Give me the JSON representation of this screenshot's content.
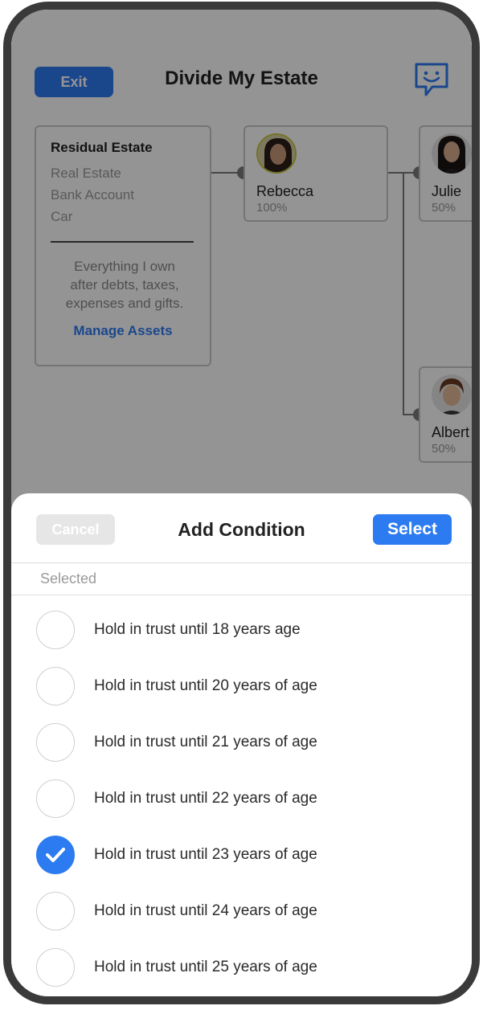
{
  "header": {
    "exit_label": "Exit",
    "title": "Divide My Estate",
    "chat_icon": "support-chat-icon"
  },
  "residual_estate": {
    "title": "Residual Estate",
    "items": [
      "Real Estate",
      "Bank Account",
      "Car"
    ],
    "description_lines": [
      "Everything I own",
      "after debts, taxes,",
      "expenses and gifts."
    ],
    "manage_link": "Manage Assets"
  },
  "beneficiaries": [
    {
      "name": "Rebecca",
      "percent": "100%"
    },
    {
      "name": "Julie",
      "percent": "50%"
    },
    {
      "name": "Albert",
      "percent": "50%"
    }
  ],
  "sheet": {
    "cancel_label": "Cancel",
    "title": "Add Condition",
    "select_label": "Select",
    "selected_label": "Selected",
    "options": [
      {
        "label": "Hold in trust until 18 years age",
        "checked": false
      },
      {
        "label": "Hold in trust until 20 years of age",
        "checked": false
      },
      {
        "label": "Hold in trust until 21 years of age",
        "checked": false
      },
      {
        "label": "Hold in trust until 22 years of age",
        "checked": false
      },
      {
        "label": "Hold in trust until 23 years of age",
        "checked": true
      },
      {
        "label": "Hold in trust until 24 years of age",
        "checked": false
      },
      {
        "label": "Hold in trust until 25 years of age",
        "checked": false
      }
    ]
  },
  "colors": {
    "accent": "#2d7bf1",
    "overlay": "rgba(0,0,0,0.42)",
    "phone_frame": "#3a3a3a"
  }
}
